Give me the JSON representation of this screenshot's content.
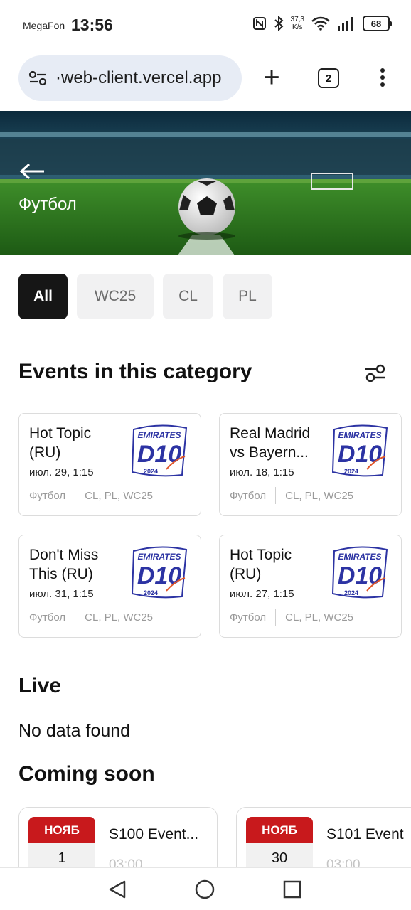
{
  "status_bar": {
    "carrier": "MegaFon",
    "time": "13:56",
    "net_speed_value": "37,3",
    "net_speed_unit": "K/s",
    "battery": "68"
  },
  "browser": {
    "url": "·web-client.vercel.app",
    "tab_count": "2"
  },
  "hero": {
    "title": "Футбол"
  },
  "chips": [
    {
      "label": "All",
      "active": true
    },
    {
      "label": "WC25",
      "active": false
    },
    {
      "label": "CL",
      "active": false
    },
    {
      "label": "PL",
      "active": false
    }
  ],
  "events_section": {
    "title": "Events in this category",
    "cards": [
      {
        "title": "Hot Topic (RU)",
        "date": "июл. 29, 1:15",
        "category": "Футбол",
        "tags": "CL, PL, WC25"
      },
      {
        "title": "Real Madrid vs Bayern...",
        "date": "июл. 18, 1:15",
        "category": "Футбол",
        "tags": "CL, PL, WC25"
      },
      {
        "title": "Don't Miss This (RU)",
        "date": "июл. 31, 1:15",
        "category": "Футбол",
        "tags": "CL, PL, WC25"
      },
      {
        "title": "Hot Topic (RU)",
        "date": "июл. 27, 1:15",
        "category": "Футбол",
        "tags": "CL, PL, WC25"
      }
    ],
    "logo": {
      "line1": "EMIRATES",
      "line2": "D10",
      "line3": "2024"
    }
  },
  "live_section": {
    "title": "Live",
    "empty_text": "No data found"
  },
  "coming_soon": {
    "title": "Coming soon",
    "items": [
      {
        "month": "НОЯБ",
        "day": "1",
        "title": "S100 Event...",
        "time": "03:00"
      },
      {
        "month": "НОЯБ",
        "day": "30",
        "title": "S101 Event",
        "time": "03:00"
      }
    ]
  },
  "colors": {
    "accent_dark": "#161616",
    "badge_red": "#c8191c",
    "url_bar_bg": "#e7ecf5"
  }
}
